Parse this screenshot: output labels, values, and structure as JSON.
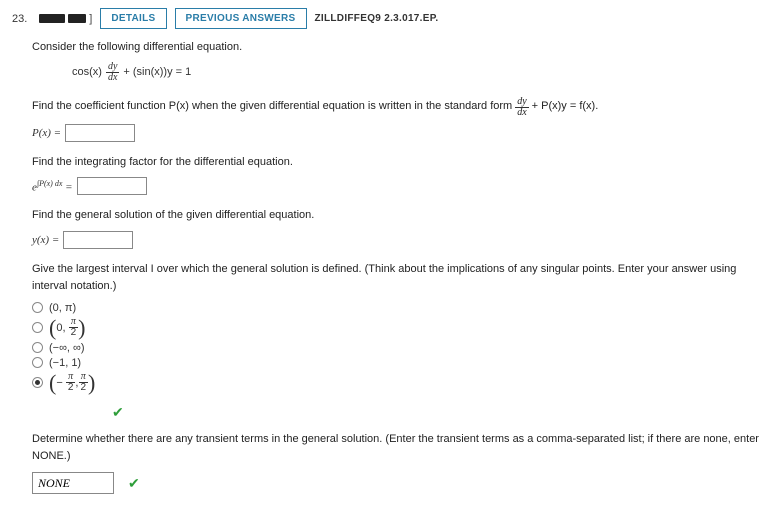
{
  "header": {
    "q_num_prefix": "23.",
    "attempt_suffix": "]",
    "details_btn": "DETAILS",
    "prev_btn": "PREVIOUS ANSWERS",
    "source": "ZILLDIFFEQ9 2.3.017.EP."
  },
  "intro": "Consider the following differential equation.",
  "eq1": {
    "lhs_cos": "cos(x)",
    "dy": "dy",
    "dx": "dx",
    "plus_siny": "+ (sin(x))y = 1"
  },
  "q1": {
    "prompt_pre": "Find the coefficient function P(x) when the given differential equation is written in the standard form ",
    "dy": "dy",
    "dx": "dx",
    "post": " + P(x)y = f(x).",
    "label": "P(x) ="
  },
  "q2": {
    "prompt": "Find the integrating factor for the differential equation.",
    "elabel_e": "e",
    "elabel_exp": "∫P(x) dx",
    "eq": "="
  },
  "q3": {
    "prompt": "Find the general solution of the given differential equation.",
    "label": "y(x) ="
  },
  "q4": {
    "prompt": "Give the largest interval I over which the general solution is defined. (Think about the implications of any singular points. Enter your answer using interval notation.)",
    "opts": {
      "a": "(0, π)",
      "b_pre": "(0, ",
      "b_num": "π",
      "b_den": "2",
      "b_post": ")",
      "c": "(−∞, ∞)",
      "d": "(−1, 1)",
      "e_pre": "(− ",
      "e_num1": "π",
      "e_den1": "2",
      "e_mid": ", ",
      "e_num2": "π",
      "e_den2": "2",
      "e_post": ")"
    }
  },
  "q5": {
    "prompt": "Determine whether there are any transient terms in the general solution. (Enter the transient terms as a comma-separated list; if there are none, enter NONE.)",
    "value": "NONE"
  }
}
